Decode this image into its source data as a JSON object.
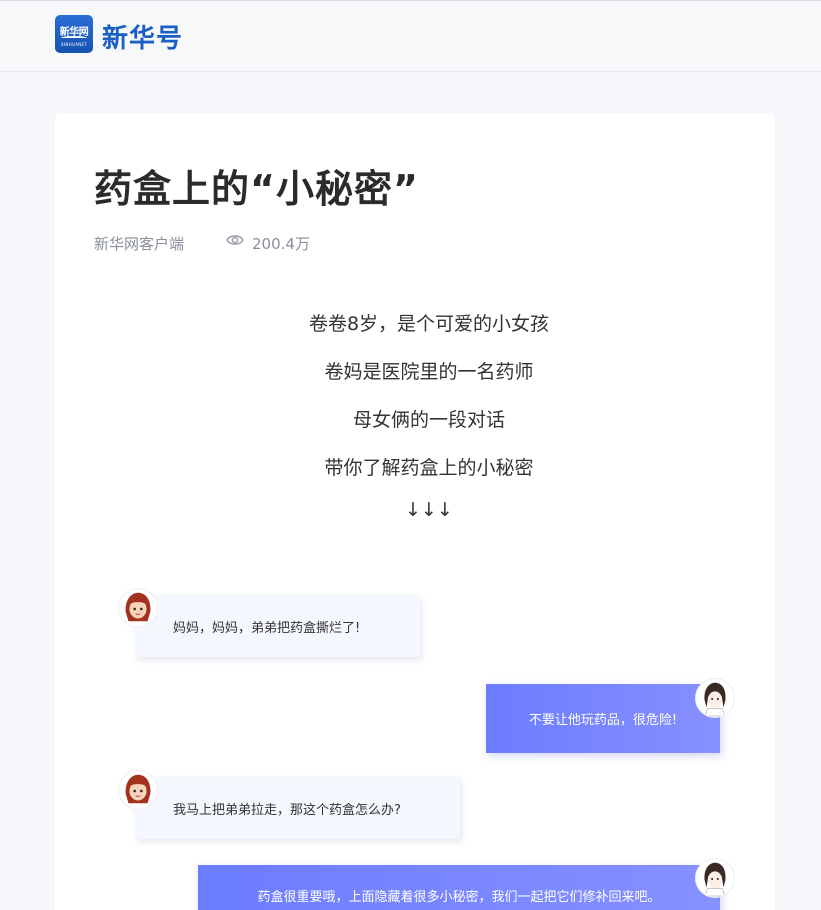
{
  "header": {
    "logo_text": "新华网",
    "logo_sub": "XINHUANET",
    "brand_name": "新华号"
  },
  "article": {
    "title": "药盒上的“小秘密”",
    "source": "新华网客户端",
    "views": "200.4万",
    "paragraphs": [
      "卷卷8岁，是个可爱的小女孩",
      "卷妈是医院里的一名药师",
      "母女俩的一段对话",
      "带你了解药盒上的小秘密",
      "↓↓↓"
    ]
  },
  "chat": [
    {
      "side": "left",
      "speaker": "girl",
      "text": "妈妈，妈妈，弟弟把药盒撕烂了!"
    },
    {
      "side": "right",
      "speaker": "mom",
      "text": "不要让他玩药品，很危险!"
    },
    {
      "side": "left",
      "speaker": "girl",
      "text": "我马上把弟弟拉走，那这个药盒怎么办?"
    },
    {
      "side": "right",
      "speaker": "mom",
      "text": "药盒很重要哦，上面隐藏着很多小秘密，我们一起把它们修补回来吧。"
    }
  ],
  "icons": {
    "views": "eye-icon",
    "girl_avatar": "girl-avatar",
    "mom_avatar": "mom-avatar"
  },
  "colors": {
    "brand_blue": "#1a5fc4",
    "bubble_gradient_start": "#6b7cff",
    "bubble_gradient_end": "#8790ff",
    "bubble_left_bg": "#f4f7fe"
  }
}
